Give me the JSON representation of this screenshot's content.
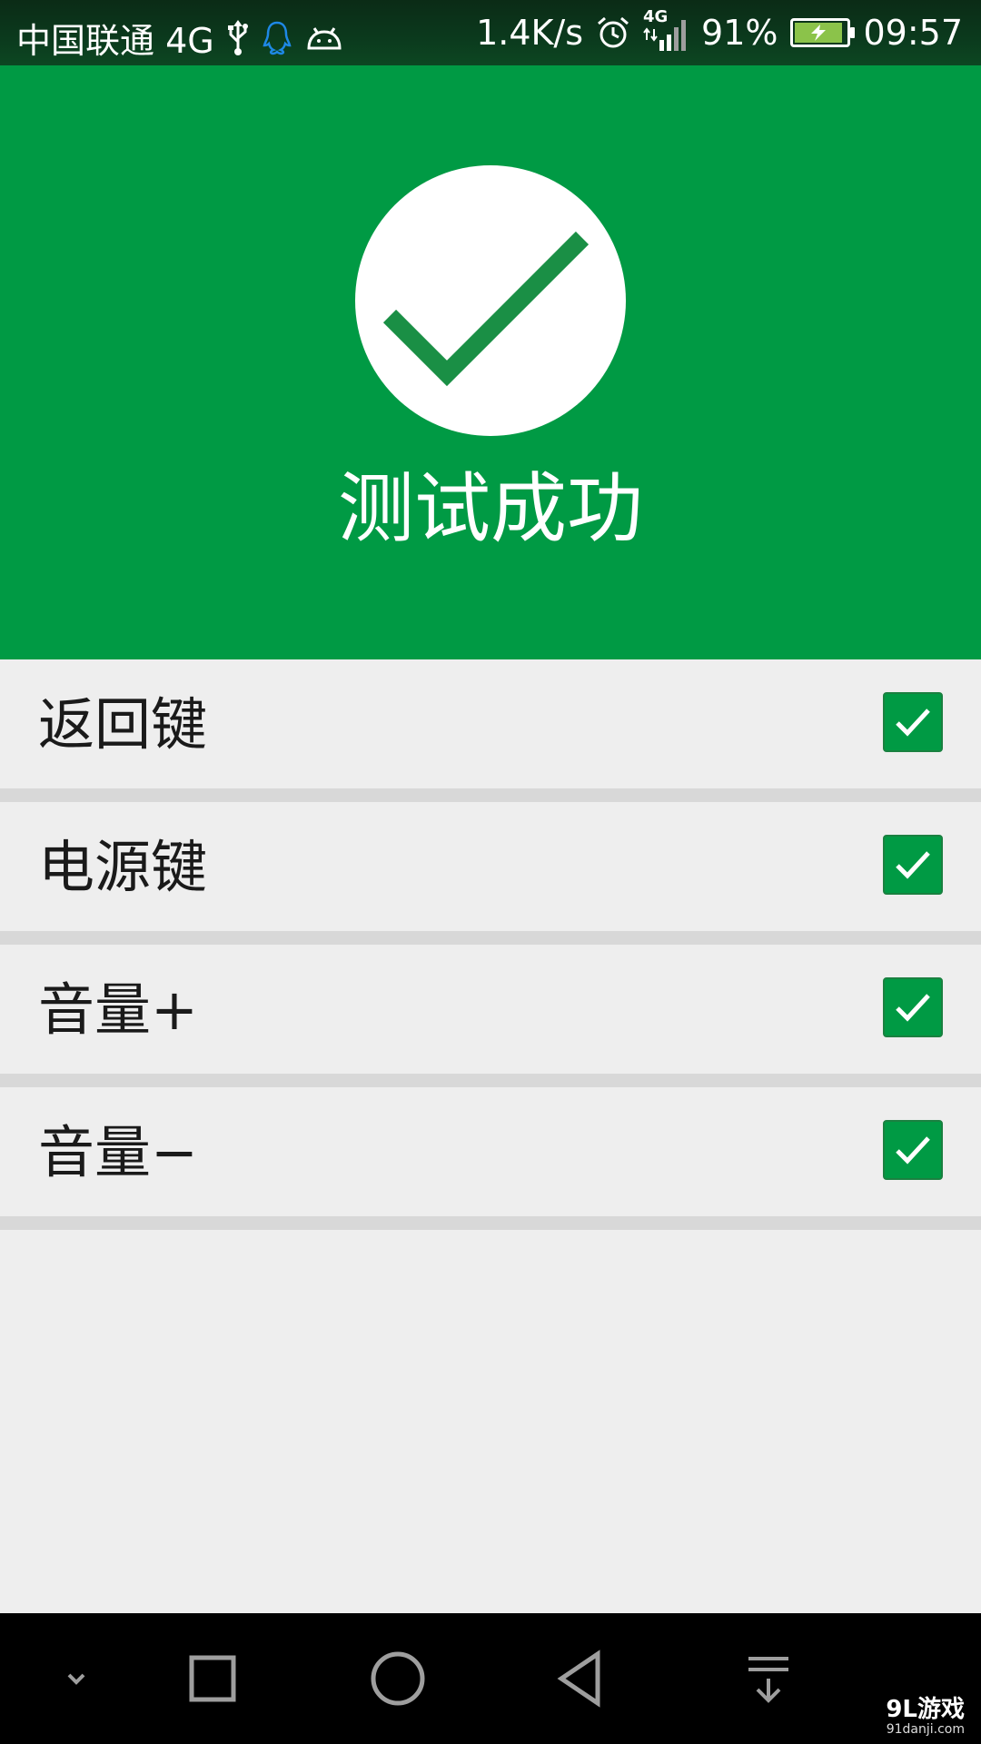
{
  "status_bar": {
    "carrier": "中国联通 4G",
    "net_speed": "1.4K/s",
    "battery_percent": "91%",
    "battery_level": 0.91,
    "time": "09:57",
    "signal_type": "4G",
    "icons": [
      "usb-icon",
      "qq-icon",
      "android-icon",
      "alarm-icon",
      "signal-icon",
      "battery-icon"
    ]
  },
  "header": {
    "title": "测试成功",
    "icon": "check-circle-icon"
  },
  "tests": [
    {
      "label": "返回键",
      "checked": true
    },
    {
      "label": "电源键",
      "checked": true
    },
    {
      "label": "音量+",
      "checked": true
    },
    {
      "label": "音量−",
      "checked": true
    }
  ],
  "nav_bar": {
    "buttons": [
      "collapse-icon",
      "recents-icon",
      "home-icon",
      "back-icon",
      "notification-pull-icon"
    ]
  },
  "watermark": {
    "logo": "9L游戏",
    "url": "91danji.com"
  },
  "colors": {
    "primary_green": "#009a44",
    "background": "#eeeeee",
    "divider": "#d8d8d8",
    "nav_background": "#000000"
  }
}
